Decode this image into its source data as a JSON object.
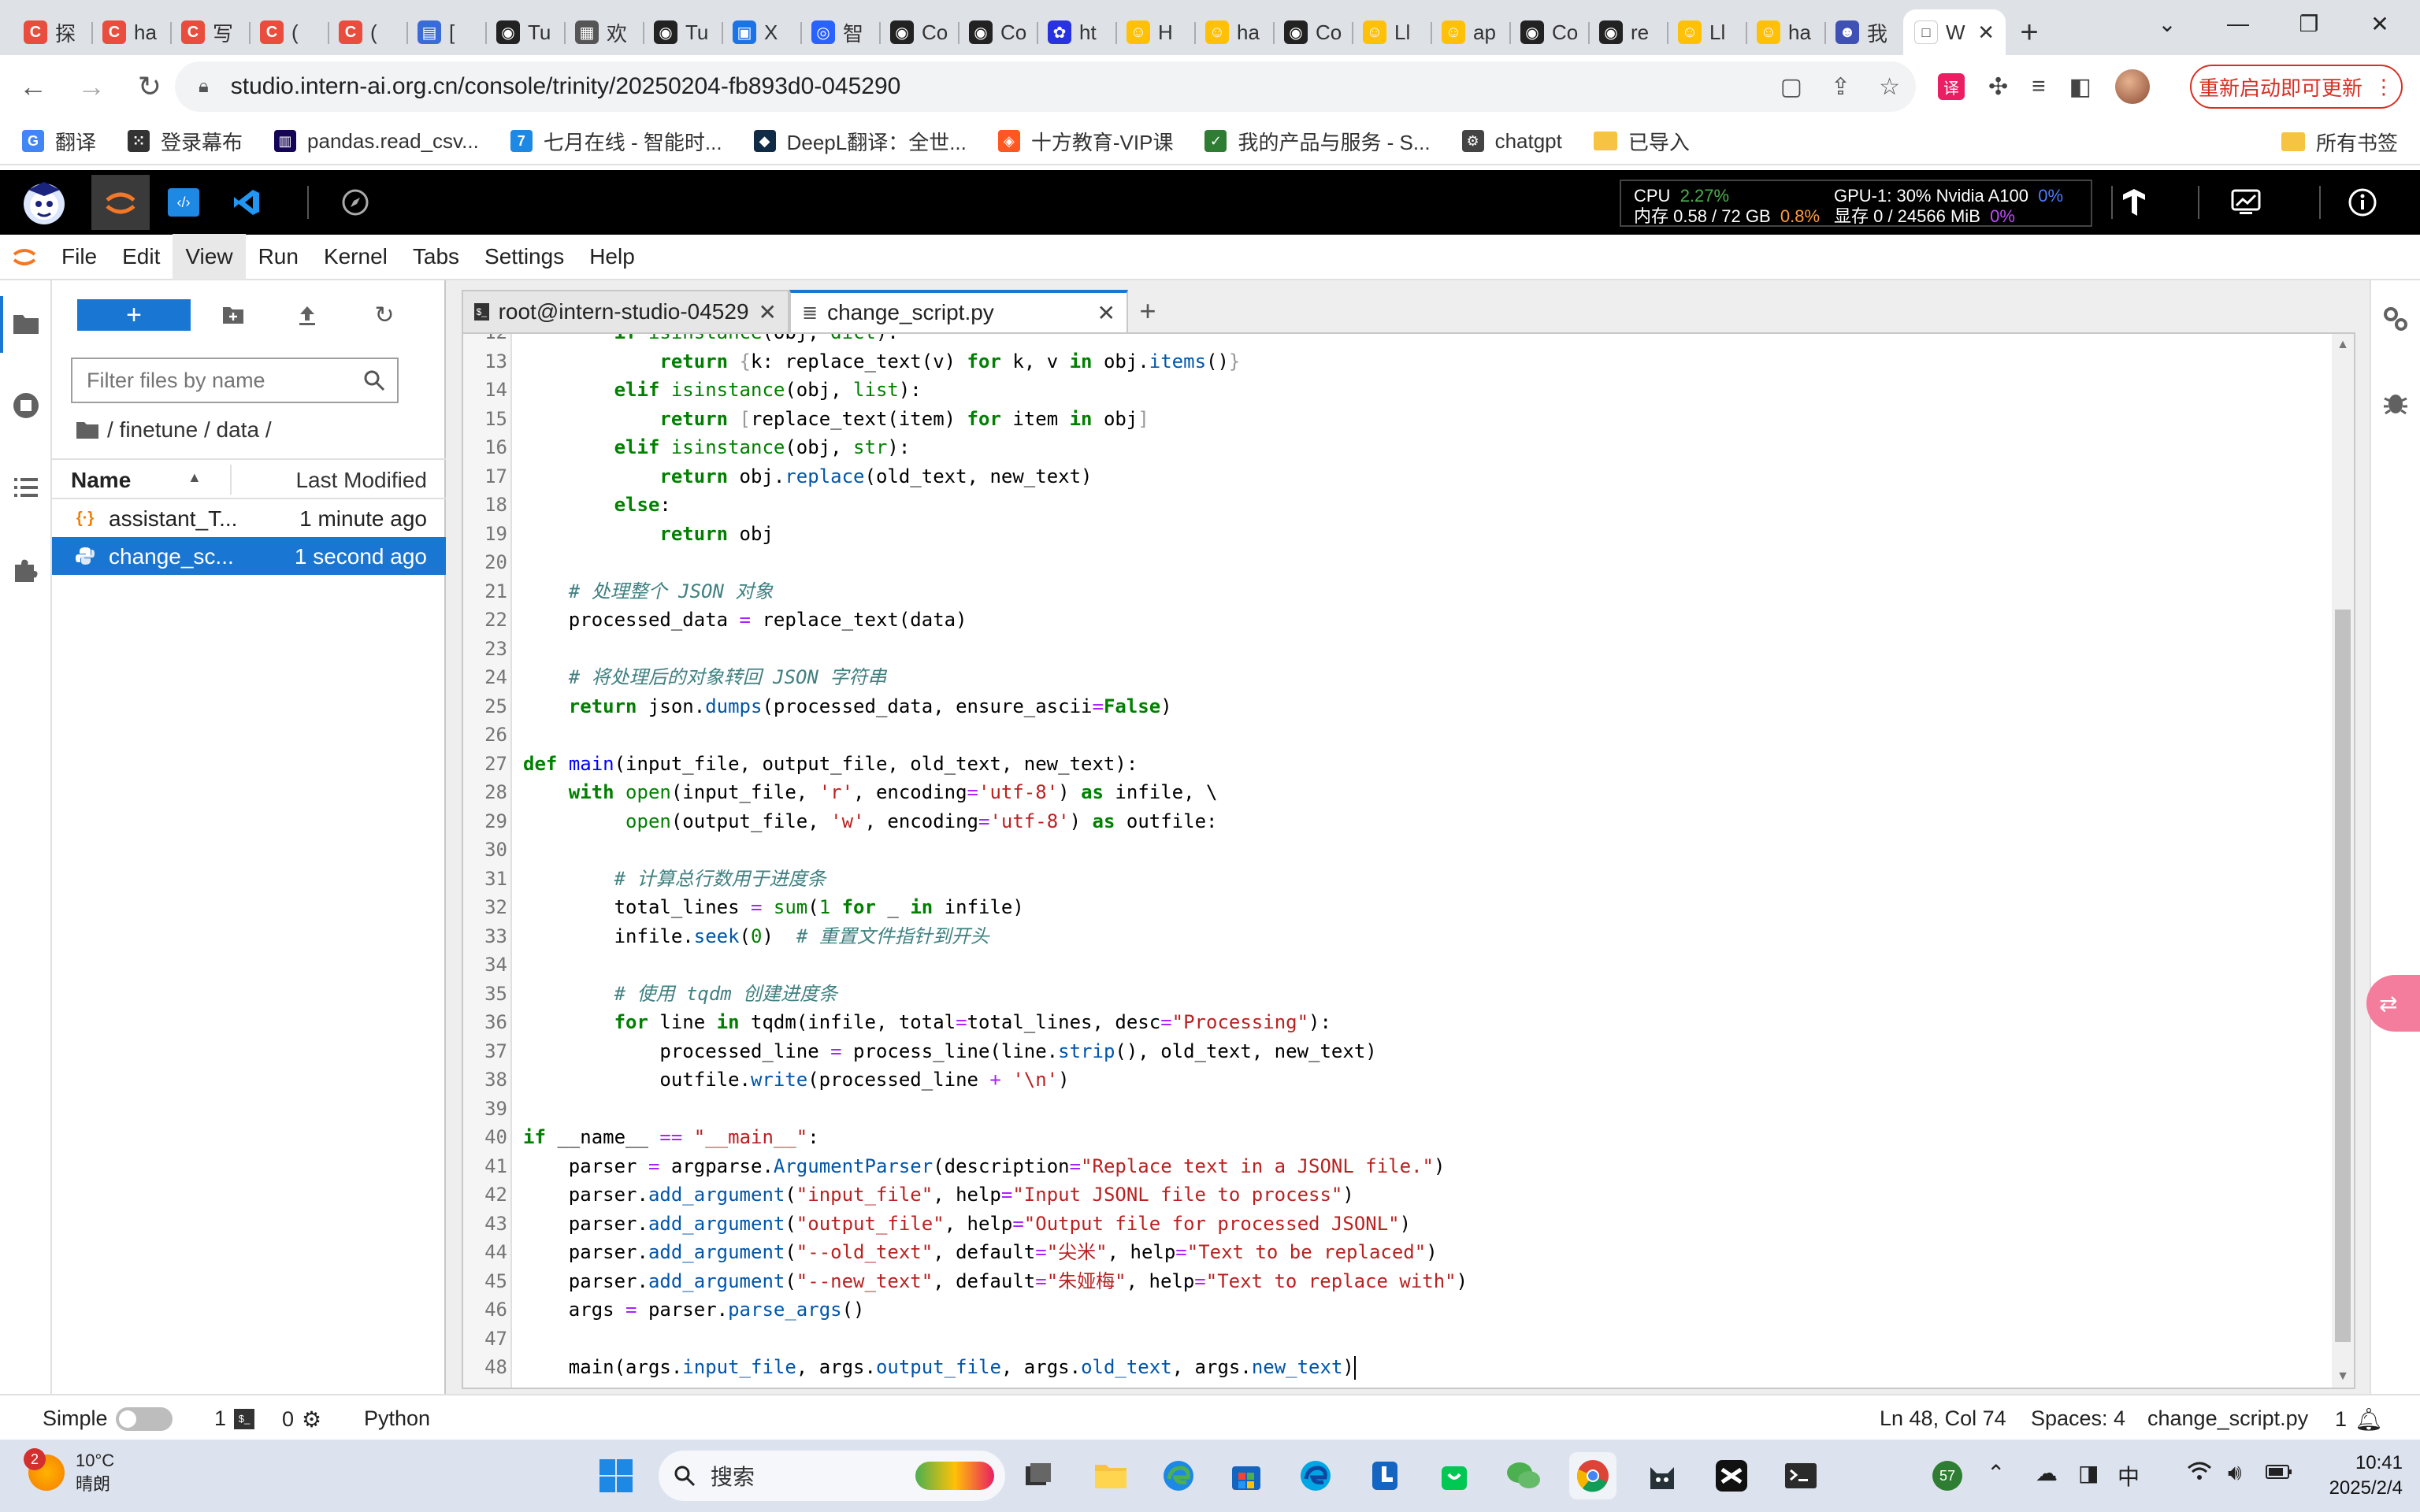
{
  "browser": {
    "tabs": [
      {
        "icon": "C",
        "color": "#e84d3d",
        "label": "探"
      },
      {
        "icon": "C",
        "color": "#e84d3d",
        "label": "ha"
      },
      {
        "icon": "C",
        "color": "#e84d3d",
        "label": "写"
      },
      {
        "icon": "C",
        "color": "#e84d3d",
        "label": "("
      },
      {
        "icon": "C",
        "color": "#e84d3d",
        "label": "("
      },
      {
        "icon": "▤",
        "color": "#3b6bd6",
        "label": "["
      },
      {
        "icon": "◉",
        "color": "#222222",
        "label": "Tu"
      },
      {
        "icon": "▦",
        "color": "#555555",
        "label": "欢"
      },
      {
        "icon": "◉",
        "color": "#222222",
        "label": "Tu"
      },
      {
        "icon": "▣",
        "color": "#1a73e8",
        "label": "X"
      },
      {
        "icon": "◎",
        "color": "#2962ff",
        "label": "智"
      },
      {
        "icon": "◉",
        "color": "#222222",
        "label": "Co"
      },
      {
        "icon": "◉",
        "color": "#222222",
        "label": "Co"
      },
      {
        "icon": "✿",
        "color": "#2932e1",
        "label": "ht"
      },
      {
        "icon": "☺",
        "color": "#ffc107",
        "label": "H"
      },
      {
        "icon": "☺",
        "color": "#ffc107",
        "label": "ha"
      },
      {
        "icon": "◉",
        "color": "#222222",
        "label": "Co"
      },
      {
        "icon": "☺",
        "color": "#ffc107",
        "label": "Ll"
      },
      {
        "icon": "☺",
        "color": "#ffc107",
        "label": "ap"
      },
      {
        "icon": "◉",
        "color": "#222222",
        "label": "Co"
      },
      {
        "icon": "◉",
        "color": "#222222",
        "label": "re"
      },
      {
        "icon": "☺",
        "color": "#ffc107",
        "label": "Ll"
      },
      {
        "icon": "☺",
        "color": "#ffc107",
        "label": "ha"
      },
      {
        "icon": "☻",
        "color": "#3f51b5",
        "label": "我"
      }
    ],
    "active_tab_label": "W",
    "url": "studio.intern-ai.org.cn/console/trinity/20250204-fb893d0-045290",
    "update_button": "重新启动即可更新",
    "bookmarks": [
      {
        "label": "翻译",
        "color": "#4285f4",
        "icon": "G"
      },
      {
        "label": "登录幕布",
        "color": "#333333",
        "icon": "⁙"
      },
      {
        "label": "pandas.read_csv...",
        "color": "#150458",
        "icon": "▥"
      },
      {
        "label": "七月在线 - 智能时...",
        "color": "#1e88e5",
        "icon": "7"
      },
      {
        "label": "DeepL翻译：全世...",
        "color": "#0f2b46",
        "icon": "◆"
      },
      {
        "label": "十方教育-VIP课",
        "color": "#ff5722",
        "icon": "◈"
      },
      {
        "label": "我的产品与服务 - S...",
        "color": "#2e7d32",
        "icon": "✓"
      },
      {
        "label": "chatgpt",
        "color": "#444444",
        "icon": "⚙"
      },
      {
        "label": "已导入",
        "color": "#f6c342",
        "icon": ""
      }
    ],
    "all_bookmarks": "所有书签"
  },
  "topbar": {
    "cpu_label": "CPU",
    "cpu_value": "2.27%",
    "mem_label": "内存 0.58 / 72 GB",
    "mem_value": "0.8%",
    "gpu_label": "GPU-1: 30% Nvidia A100",
    "gpu_value": "0%",
    "vram_label": "显存 0 / 24566 MiB",
    "vram_value": "0%"
  },
  "menubar": {
    "items": [
      "File",
      "Edit",
      "View",
      "Run",
      "Kernel",
      "Tabs",
      "Settings",
      "Help"
    ]
  },
  "filebrowser": {
    "filter_placeholder": "Filter files by name",
    "breadcrumb": "/ finetune / data /",
    "col_name": "Name",
    "col_modified": "Last Modified",
    "files": [
      {
        "name": "assistant_T...",
        "modified": "1 minute ago",
        "type": "json"
      },
      {
        "name": "change_sc...",
        "modified": "1 second ago",
        "type": "python"
      }
    ]
  },
  "tabs": [
    {
      "label": "root@intern-studio-04529",
      "type": "terminal"
    },
    {
      "label": "change_script.py",
      "type": "file"
    }
  ],
  "editor": {
    "lines": [
      {
        "n": "12",
        "html": "        <span class=\"kw\">if</span> <span class=\"bi\">isinstance</span>(obj, <span class=\"bi\">dict</span>):"
      },
      {
        "n": "13",
        "html": "            <span class=\"kw\">return</span> <span class=\"br\">{</span>k: replace_text(v) <span class=\"kw\">for</span> k, v <span class=\"kw\">in</span> obj.<span class=\"attr\">items</span>()<span class=\"br\">}</span>"
      },
      {
        "n": "14",
        "html": "        <span class=\"kw\">elif</span> <span class=\"bi\">isinstance</span>(obj, <span class=\"bi\">list</span>):"
      },
      {
        "n": "15",
        "html": "            <span class=\"kw\">return</span> <span class=\"br\">[</span>replace_text(item) <span class=\"kw\">for</span> item <span class=\"kw\">in</span> obj<span class=\"br\">]</span>"
      },
      {
        "n": "16",
        "html": "        <span class=\"kw\">elif</span> <span class=\"bi\">isinstance</span>(obj, <span class=\"bi\">str</span>):"
      },
      {
        "n": "17",
        "html": "            <span class=\"kw\">return</span> obj.<span class=\"attr\">replace</span>(old_text, new_text)"
      },
      {
        "n": "18",
        "html": "        <span class=\"kw\">else</span>:"
      },
      {
        "n": "19",
        "html": "            <span class=\"kw\">return</span> obj"
      },
      {
        "n": "20",
        "html": ""
      },
      {
        "n": "21",
        "html": "    <span class=\"cm\"># 处理整个 JSON 对象</span>"
      },
      {
        "n": "22",
        "html": "    processed_data <span class=\"op\">=</span> replace_text(data)"
      },
      {
        "n": "23",
        "html": ""
      },
      {
        "n": "24",
        "html": "    <span class=\"cm\"># 将处理后的对象转回 JSON 字符串</span>"
      },
      {
        "n": "25",
        "html": "    <span class=\"kw\">return</span> json.<span class=\"attr\">dumps</span>(processed_data, ensure_ascii<span class=\"op\">=</span><span class=\"kw\">False</span>)"
      },
      {
        "n": "26",
        "html": ""
      },
      {
        "n": "27",
        "html": "<span class=\"kw\">def</span> <span class=\"fn\">main</span>(input_file, output_file, old_text, new_text):"
      },
      {
        "n": "28",
        "html": "    <span class=\"kw\">with</span> <span class=\"bi\">open</span>(input_file, <span class=\"str\">'r'</span>, encoding<span class=\"op\">=</span><span class=\"str\">'utf-8'</span>) <span class=\"kw\">as</span> infile, \\"
      },
      {
        "n": "29",
        "html": "         <span class=\"bi\">open</span>(output_file, <span class=\"str\">'w'</span>, encoding<span class=\"op\">=</span><span class=\"str\">'utf-8'</span>) <span class=\"kw\">as</span> outfile:"
      },
      {
        "n": "30",
        "html": ""
      },
      {
        "n": "31",
        "html": "        <span class=\"cm\"># 计算总行数用于进度条</span>"
      },
      {
        "n": "32",
        "html": "        total_lines <span class=\"op\">=</span> <span class=\"bi\">sum</span>(<span class=\"num\">1</span> <span class=\"kw\">for</span> _ <span class=\"kw\">in</span> infile)"
      },
      {
        "n": "33",
        "html": "        infile.<span class=\"attr\">seek</span>(<span class=\"num\">0</span>)  <span class=\"cm\"># 重置文件指针到开头</span>"
      },
      {
        "n": "34",
        "html": ""
      },
      {
        "n": "35",
        "html": "        <span class=\"cm\"># 使用 tqdm 创建进度条</span>"
      },
      {
        "n": "36",
        "html": "        <span class=\"kw\">for</span> line <span class=\"kw\">in</span> tqdm(infile, total<span class=\"op\">=</span>total_lines, desc<span class=\"op\">=</span><span class=\"str\">\"Processing\"</span>):"
      },
      {
        "n": "37",
        "html": "            processed_line <span class=\"op\">=</span> process_line(line.<span class=\"attr\">strip</span>(), old_text, new_text)"
      },
      {
        "n": "38",
        "html": "            outfile.<span class=\"attr\">write</span>(processed_line <span class=\"op\">+</span> <span class=\"str\">'\\n'</span>)"
      },
      {
        "n": "39",
        "html": ""
      },
      {
        "n": "40",
        "html": "<span class=\"kw\">if</span> __name__ <span class=\"op\">==</span> <span class=\"str\">\"__main__\"</span>:"
      },
      {
        "n": "41",
        "html": "    parser <span class=\"op\">=</span> argparse.<span class=\"attr\">ArgumentParser</span>(description<span class=\"op\">=</span><span class=\"str\">\"Replace text in a JSONL file.\"</span>)"
      },
      {
        "n": "42",
        "html": "    parser.<span class=\"attr\">add_argument</span>(<span class=\"str\">\"input_file\"</span>, help<span class=\"op\">=</span><span class=\"str\">\"Input JSONL file to process\"</span>)"
      },
      {
        "n": "43",
        "html": "    parser.<span class=\"attr\">add_argument</span>(<span class=\"str\">\"output_file\"</span>, help<span class=\"op\">=</span><span class=\"str\">\"Output file for processed JSONL\"</span>)"
      },
      {
        "n": "44",
        "html": "    parser.<span class=\"attr\">add_argument</span>(<span class=\"str\">\"--old_text\"</span>, default<span class=\"op\">=</span><span class=\"str\">\"尖米\"</span>, help<span class=\"op\">=</span><span class=\"str\">\"Text to be replaced\"</span>)"
      },
      {
        "n": "45",
        "html": "    parser.<span class=\"attr\">add_argument</span>(<span class=\"str\">\"--new_text\"</span>, default<span class=\"op\">=</span><span class=\"str\">\"朱娅梅\"</span>, help<span class=\"op\">=</span><span class=\"str\">\"Text to replace with\"</span>)"
      },
      {
        "n": "46",
        "html": "    args <span class=\"op\">=</span> parser.<span class=\"attr\">parse_args</span>()"
      },
      {
        "n": "47",
        "html": ""
      },
      {
        "n": "48",
        "html": "    main(args.<span class=\"attr\">input_file</span>, args.<span class=\"attr\">output_file</span>, args.<span class=\"attr\">old_text</span>, args.<span class=\"attr\">new_text</span>)<span class=\"cursor\"></span>"
      }
    ]
  },
  "statusbar": {
    "mode": "Simple",
    "terminals": "1",
    "kernels": "0",
    "kernel_name": "Python",
    "position": "Ln 48, Col 74",
    "spaces": "Spaces: 4",
    "filename": "change_script.py",
    "notifications": "1"
  },
  "taskbar": {
    "weather_temp": "10°C",
    "weather_desc": "晴朗",
    "weather_badge": "2",
    "search_placeholder": "搜索",
    "green_badge": "57",
    "ime": "中",
    "time": "10:41",
    "date": "2025/2/4"
  },
  "colors": {
    "jupyter_blue": "#1976d2",
    "topbar_black": "#000000",
    "update_red": "#d93025"
  }
}
